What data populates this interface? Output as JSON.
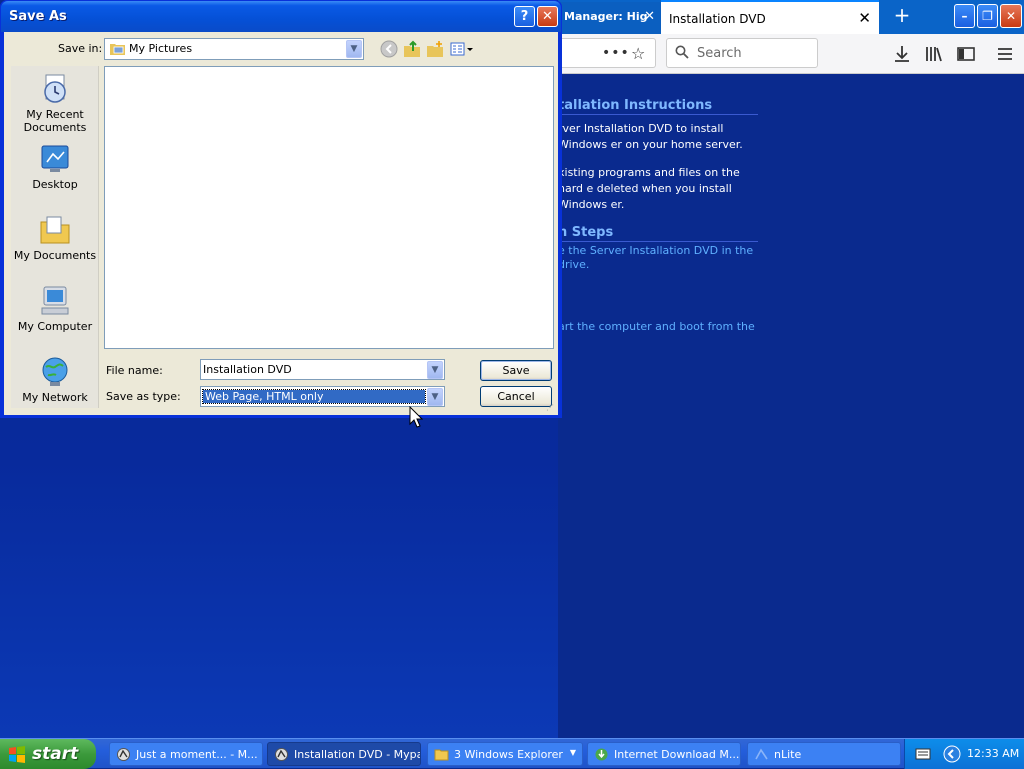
{
  "browser": {
    "tabs": [
      {
        "label": "Manager: Hig",
        "close": "✕"
      },
      {
        "label": "Installation DVD",
        "close": "✕"
      }
    ],
    "new_tab": "+",
    "window_buttons": {
      "min": "–",
      "max": "❐",
      "close": "✕"
    },
    "url_dots": "•••",
    "bookmark_icon": "☆",
    "search_placeholder": "Search",
    "toolbar_icons": [
      "download-icon",
      "library-icon",
      "sidebar-icon",
      "menu-icon"
    ]
  },
  "page": {
    "heading1": "tallation Instructions",
    "para1": "rver Installation DVD to install Windows er on your home server.",
    "para2": "xisting programs and files on the hard e deleted when you install Windows er.",
    "heading2": "n Steps",
    "step1": "e the Server Installation DVD in the drive.",
    "step2": "art the computer and boot from the ."
  },
  "dialog": {
    "title": "Save As",
    "help_button": "?",
    "close_button": "✕",
    "save_in_label": "Save in:",
    "save_in_value": "My Pictures",
    "places": [
      "My Recent Documents",
      "Desktop",
      "My Documents",
      "My Computer",
      "My Network"
    ],
    "file_name_label": "File name:",
    "file_name_value": "Installation DVD",
    "save_as_type_label": "Save as type:",
    "save_as_type_value": "Web Page, HTML only",
    "save_button": "Save",
    "cancel_button": "Cancel"
  },
  "taskbar": {
    "start": "start",
    "tasks": [
      {
        "label": "Just a moment... - M...",
        "active": false
      },
      {
        "label": "Installation DVD - Mypal",
        "active": true
      },
      {
        "label": "3 Windows Explorer",
        "active": false
      },
      {
        "label": "Internet Download M...",
        "active": false
      },
      {
        "label": "nLite",
        "active": false
      }
    ],
    "clock": "12:33 AM"
  }
}
